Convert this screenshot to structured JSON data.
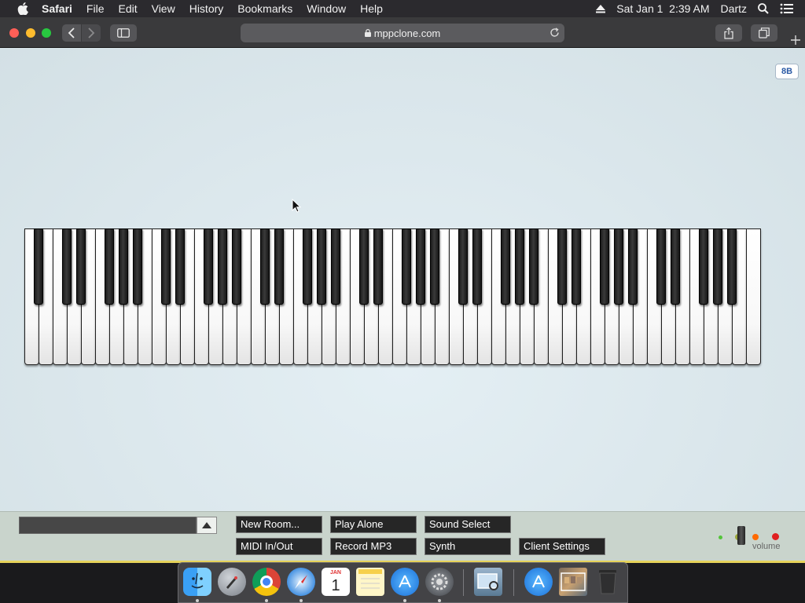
{
  "menubar": {
    "app_name": "Safari",
    "menus": [
      "File",
      "Edit",
      "View",
      "History",
      "Bookmarks",
      "Window",
      "Help"
    ],
    "clock": "Sat Jan 1  2:39 AM",
    "user": "Dartz"
  },
  "browser": {
    "url": "mppclone.com"
  },
  "page": {
    "badge": "8B",
    "keyboard": {
      "white_key_count": 52,
      "black_key_pattern": [
        1,
        0,
        1,
        1,
        0,
        1,
        1,
        1
      ]
    }
  },
  "controls": {
    "chat_placeholder": "",
    "buttons": {
      "new_room": "New Room...",
      "play_alone": "Play Alone",
      "sound_select": "Sound Select",
      "midi": "MIDI In/Out",
      "record_mp3": "Record MP3",
      "synth": "Synth",
      "client_settings": "Client Settings"
    },
    "volume_label": "volume",
    "status_colors": [
      "#53c43a",
      "#9aa63a",
      "#ff6a00",
      "#e02020"
    ]
  },
  "dock": {
    "calendar_month": "JAN",
    "calendar_day": "1"
  },
  "colors": {
    "menubar": "#2b2a2e",
    "toolbar": "#3a3a3c",
    "page_bg": "#dbe7ec",
    "control_bar": "#c9d4cc",
    "button_bg": "#262626"
  }
}
